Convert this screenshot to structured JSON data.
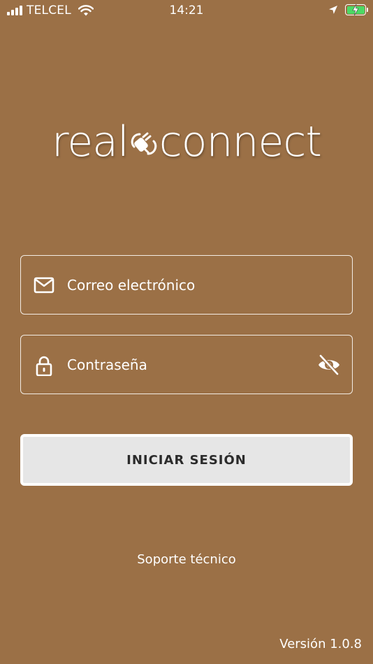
{
  "status_bar": {
    "carrier": "TELCEL",
    "time": "14:21",
    "battery_color": "#4cd964"
  },
  "logo": {
    "left_text": "real",
    "right_text": "connect",
    "icon": "plug-icon"
  },
  "form": {
    "email": {
      "placeholder": "Correo electrónico",
      "value": "",
      "icon": "mail-icon"
    },
    "password": {
      "placeholder": "Contraseña",
      "value": "",
      "icon": "lock-icon",
      "toggle_icon": "eye-off-icon"
    },
    "login_label": "INICIAR SESIÓN"
  },
  "support_label": "Soporte técnico",
  "version": "Versión 1.0.8",
  "colors": {
    "background": "#9b7046",
    "button_bg": "#e6e6e6",
    "button_text": "#2b2b2b"
  }
}
